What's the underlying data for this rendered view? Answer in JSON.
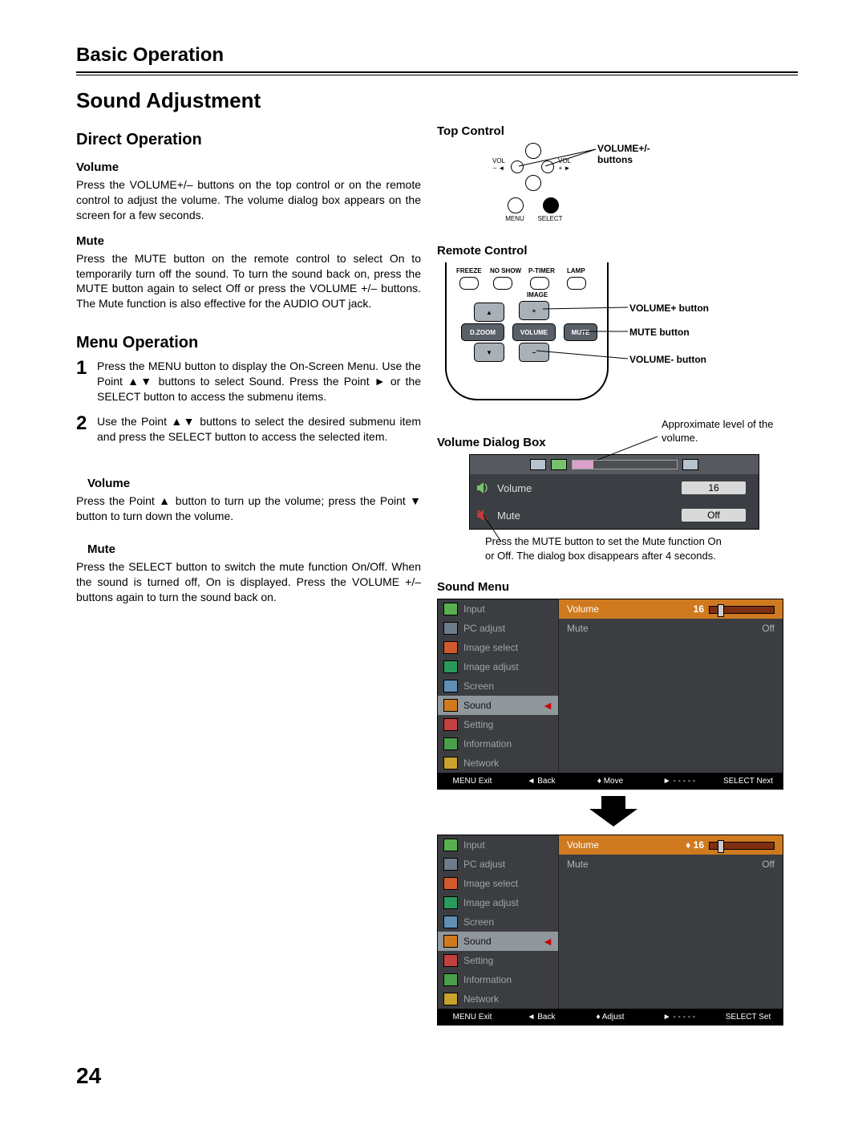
{
  "chapter": "Basic Operation",
  "section": "Sound Adjustment",
  "pageNumber": "24",
  "direct": {
    "heading": "Direct Operation",
    "volumeH": "Volume",
    "volumeP": "Press the VOLUME+/– buttons on the top control or on the remote control to adjust the volume. The volume dialog box appears on the screen for a few seconds.",
    "muteH": "Mute",
    "muteP": "Press the MUTE button on the remote control to select On to temporarily turn off the sound. To turn the sound back on, press the MUTE button again to select Off or press the VOLUME +/– buttons. The Mute function is also effective for the AUDIO OUT jack."
  },
  "menuOp": {
    "heading": "Menu Operation",
    "step1": "Press the MENU button to display the On-Screen Menu. Use the Point ▲▼ buttons to select Sound. Press the Point ► or the SELECT button to access the submenu items.",
    "step2": "Use the Point ▲▼ buttons to select the desired submenu item and press the SELECT button to access the selected item.",
    "volumeH": "Volume",
    "volumeP": "Press the Point ▲ button to turn up the volume; press the Point ▼ button to turn down the volume.",
    "muteH": "Mute",
    "muteP": "Press the SELECT button to switch the mute function On/Off. When the sound is turned off, On is displayed. Press the VOLUME +/– buttons again to turn the sound back on."
  },
  "topCtrl": {
    "heading": "Top Control",
    "call": "VOLUME+/- buttons",
    "labels": {
      "volMinus": "VOL\n– ◄",
      "volPlus": "VOL\n+ ►",
      "up": "▲",
      "down": "▼",
      "menu": "MENU",
      "select": "SELECT"
    }
  },
  "remote": {
    "heading": "Remote Control",
    "topLabels": [
      "FREEZE",
      "NO SHOW",
      "P-TIMER",
      "LAMP"
    ],
    "image": "IMAGE",
    "dzoom": "D.ZOOM",
    "volume": "VOLUME",
    "mute": "MUTE",
    "callVolPlus": "VOLUME+ button",
    "callMute": "MUTE button",
    "callVolMinus": "VOLUME- button"
  },
  "vdb": {
    "heading": "Volume Dialog Box",
    "approxNote": "Approximate level of the volume.",
    "volume": "Volume",
    "volVal": "16",
    "mute": "Mute",
    "muteVal": "Off",
    "note": "Press the MUTE button to set the Mute function On or Off. The dialog box disappears after 4 seconds."
  },
  "soundMenu": {
    "heading": "Sound Menu",
    "items": [
      "Input",
      "PC adjust",
      "Image select",
      "Image adjust",
      "Screen",
      "Sound",
      "Setting",
      "Information",
      "Network"
    ],
    "rightVol": "Volume",
    "rightVolVal": "16",
    "rightMute": "Mute",
    "rightMuteVal": "Off",
    "footer1": [
      "MENU Exit",
      "◄ Back",
      "♦ Move",
      "► - - - - -",
      "SELECT Next"
    ],
    "footer2": [
      "MENU Exit",
      "◄ Back",
      "♦ Adjust",
      "► - - - - -",
      "SELECT Set"
    ],
    "iconColors": [
      "#5ab04e",
      "#6c7c8a",
      "#d05a2e",
      "#2a9a5c",
      "#5f8fb5",
      "#d07a1f",
      "#c44040",
      "#4aa04a",
      "#c9a32e"
    ]
  }
}
